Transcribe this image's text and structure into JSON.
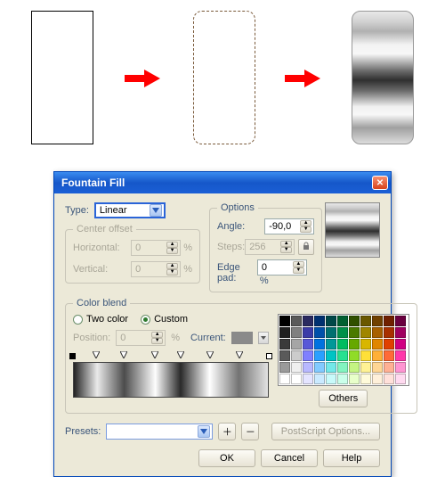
{
  "dialog": {
    "title": "Fountain Fill",
    "type_label": "Type:",
    "type_value": "Linear",
    "center_offset": {
      "legend": "Center offset",
      "h_label": "Horizontal:",
      "h_value": "0",
      "v_label": "Vertical:",
      "v_value": "0",
      "unit": "%"
    },
    "options": {
      "legend": "Options",
      "angle_label": "Angle:",
      "angle_value": "-90,0",
      "steps_label": "Steps:",
      "steps_value": "256",
      "edgepad_label": "Edge pad:",
      "edgepad_value": "0",
      "edgepad_unit": "%"
    },
    "color_blend": {
      "legend": "Color blend",
      "two_color": "Two color",
      "custom": "Custom",
      "position_label": "Position:",
      "position_value": "0",
      "position_unit": "%",
      "current_label": "Current:",
      "others_btn": "Others"
    },
    "presets_label": "Presets:",
    "presets_value": "",
    "postscript_btn": "PostScript Options...",
    "ok": "OK",
    "cancel": "Cancel",
    "help": "Help"
  },
  "palette": [
    "#000000",
    "#5a5a5a",
    "#2a2a60",
    "#003070",
    "#004848",
    "#006030",
    "#305000",
    "#6a5800",
    "#704000",
    "#702000",
    "#6a0040",
    "#202020",
    "#808080",
    "#3b3ba8",
    "#0050aa",
    "#007070",
    "#009048",
    "#4a7a00",
    "#a08600",
    "#a86000",
    "#a83000",
    "#a00060",
    "#3a3a3a",
    "#a6a6a6",
    "#5858d8",
    "#0072e0",
    "#009898",
    "#00bc60",
    "#66a800",
    "#d8b600",
    "#e08600",
    "#e04000",
    "#d00082",
    "#5a5a5a",
    "#cccccc",
    "#8080ff",
    "#2aa0ff",
    "#00c4c4",
    "#28e090",
    "#90dc28",
    "#ffe038",
    "#ffb038",
    "#ff6a38",
    "#ff38aa",
    "#9a9a9a",
    "#f0f0f0",
    "#b8b8ff",
    "#82caff",
    "#72e8e8",
    "#82f4c0",
    "#c4f482",
    "#fff294",
    "#ffd694",
    "#ffb094",
    "#ff94d2",
    "#ffffff",
    "#ffffff",
    "#e4e4ff",
    "#caeaff",
    "#c8fafa",
    "#caffea",
    "#e8ffca",
    "#fffbda",
    "#fff0da",
    "#ffe0da",
    "#ffdaf0"
  ],
  "chart_data": {
    "type": "gradient",
    "direction": "vertical",
    "angle": -90,
    "stops": [
      {
        "pos": 0,
        "color": "#222222"
      },
      {
        "pos": 12,
        "color": "#eaeaea"
      },
      {
        "pos": 26,
        "color": "#4c4c4c"
      },
      {
        "pos": 42,
        "color": "#fdfdfd"
      },
      {
        "pos": 55,
        "color": "#2a2a2a"
      },
      {
        "pos": 70,
        "color": "#ffffff"
      },
      {
        "pos": 85,
        "color": "#737373"
      },
      {
        "pos": 100,
        "color": "#e2e2e2"
      }
    ]
  }
}
